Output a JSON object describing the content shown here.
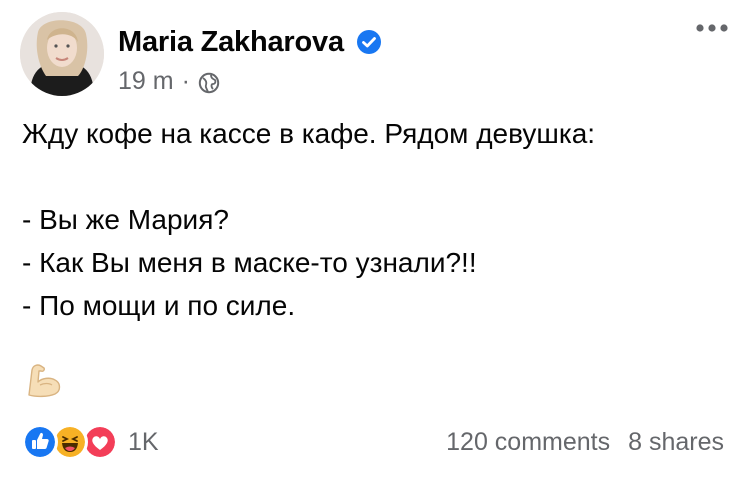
{
  "post": {
    "author_name": "Maria Zakharova",
    "verified": true,
    "time": "19 m",
    "separator": "·",
    "audience_icon": "globe-icon",
    "more_icon": "ellipsis-icon",
    "lines": [
      "Жду кофе на кассе в кафе. Рядом девушка:",
      "",
      "- Вы же Мария?",
      "- Как Вы меня в маске-то узнали?!!",
      "- По мощи и по силе."
    ],
    "emoji": "muscle-icon",
    "reactions": {
      "icons": [
        "like-icon",
        "haha-icon",
        "love-icon"
      ],
      "count": "1K"
    },
    "comments": "120 comments",
    "shares": "8 shares"
  },
  "colors": {
    "primary_text": "#050505",
    "secondary_text": "#65676b",
    "verified_blue": "#1877f2",
    "like_blue": "#1877f2",
    "haha_yellow": "#f7b125",
    "love_red": "#f33e58"
  }
}
